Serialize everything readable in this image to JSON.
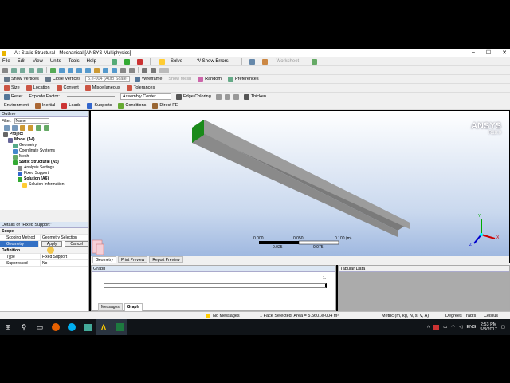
{
  "window": {
    "title": "A : Static Structural - Mechanical [ANSYS Multiphysics]",
    "controls": [
      "–",
      "☐",
      "✕"
    ]
  },
  "menu": [
    "File",
    "Edit",
    "View",
    "Units",
    "Tools",
    "Help"
  ],
  "toolbar1": {
    "solve": "Solve",
    "show_errors": "?/ Show Errors",
    "worksheet": "Worksheet"
  },
  "toolbar2": {
    "show_vertices": "Show Vertices",
    "close_vertices": "Close Vertices",
    "scale": "5.e-004 (Auto Scale)",
    "wireframe": "Wireframe",
    "show_mesh": "Show Mesh",
    "random": "Random",
    "preferences": "Preferences"
  },
  "toolbar3": {
    "size": "Size",
    "location": "Location",
    "convert": "Convert",
    "miscellaneous": "Miscellaneous",
    "tolerances": "Tolerances"
  },
  "toolbar4": {
    "reset": "Reset",
    "explode_factor": "Explode Factor:",
    "assembly_center": "Assembly Center",
    "edge_coloring": "Edge Coloring",
    "thicken": "Thicken"
  },
  "toolbar5": {
    "environment": "Environment",
    "inertial": "Inertial",
    "loads": "Loads",
    "supports": "Supports",
    "conditions": "Conditions",
    "direct_fe": "Direct FE"
  },
  "outline": {
    "title": "Outline",
    "filter_label": "Filter:",
    "filter_value": "Name",
    "tree": [
      {
        "label": "Project",
        "level": 0,
        "bold": true,
        "icon": "project-icon"
      },
      {
        "label": "Model (A4)",
        "level": 1,
        "bold": true,
        "icon": "model-icon"
      },
      {
        "label": "Geometry",
        "level": 2,
        "bold": false,
        "icon": "geometry-icon"
      },
      {
        "label": "Coordinate Systems",
        "level": 2,
        "bold": false,
        "icon": "coordinate-icon"
      },
      {
        "label": "Mesh",
        "level": 2,
        "bold": false,
        "icon": "mesh-icon"
      },
      {
        "label": "Static Structural (A5)",
        "level": 2,
        "bold": true,
        "icon": "analysis-icon"
      },
      {
        "label": "Analysis Settings",
        "level": 3,
        "bold": false,
        "icon": "settings-icon"
      },
      {
        "label": "Fixed Support",
        "level": 3,
        "bold": false,
        "icon": "support-icon"
      },
      {
        "label": "Solution (A6)",
        "level": 3,
        "bold": true,
        "icon": "solution-icon"
      },
      {
        "label": "Solution Information",
        "level": 4,
        "bold": false,
        "icon": "info-icon"
      }
    ]
  },
  "details": {
    "title": "Details of \"Fixed Support\"",
    "scope": "Scope",
    "scoping_method_label": "Scoping Method",
    "scoping_method_value": "Geometry Selection",
    "geometry_label": "Geometry",
    "apply": "Apply",
    "cancel": "Cancel",
    "definition": "Definition",
    "type_label": "Type",
    "type_value": "Fixed Support",
    "suppressed_label": "Suppressed",
    "suppressed_value": "No"
  },
  "viewport": {
    "brand": "ANSYS",
    "version": "R18.0",
    "scale_labels": [
      "0.000",
      "0.050",
      "0.100 (m)",
      "0.025",
      "0.075"
    ],
    "axis_labels": [
      "Y",
      "X",
      "Z"
    ]
  },
  "view_tabs": [
    "Geometry",
    "Print Preview",
    "Report Preview"
  ],
  "graph": {
    "title": "Graph",
    "tick": "1.",
    "tabs": [
      "Messages",
      "Graph"
    ]
  },
  "tabular": {
    "title": "Tabular Data"
  },
  "status": {
    "messages": "No Messages",
    "selection": "1 Face Selected: Area = 5.5601e-004 m²",
    "units": "Metric (m, kg, N, s, V, A)",
    "angle": "Degrees",
    "rate": "rad/s",
    "temp": "Celsius"
  },
  "taskbar": {
    "lang": "ENG",
    "time": "2:53 PM",
    "date": "5/3/2017"
  },
  "colors": {
    "accent": "#2b579a",
    "face_green": "#1a8a1a",
    "beam": "#9c9c9c"
  }
}
